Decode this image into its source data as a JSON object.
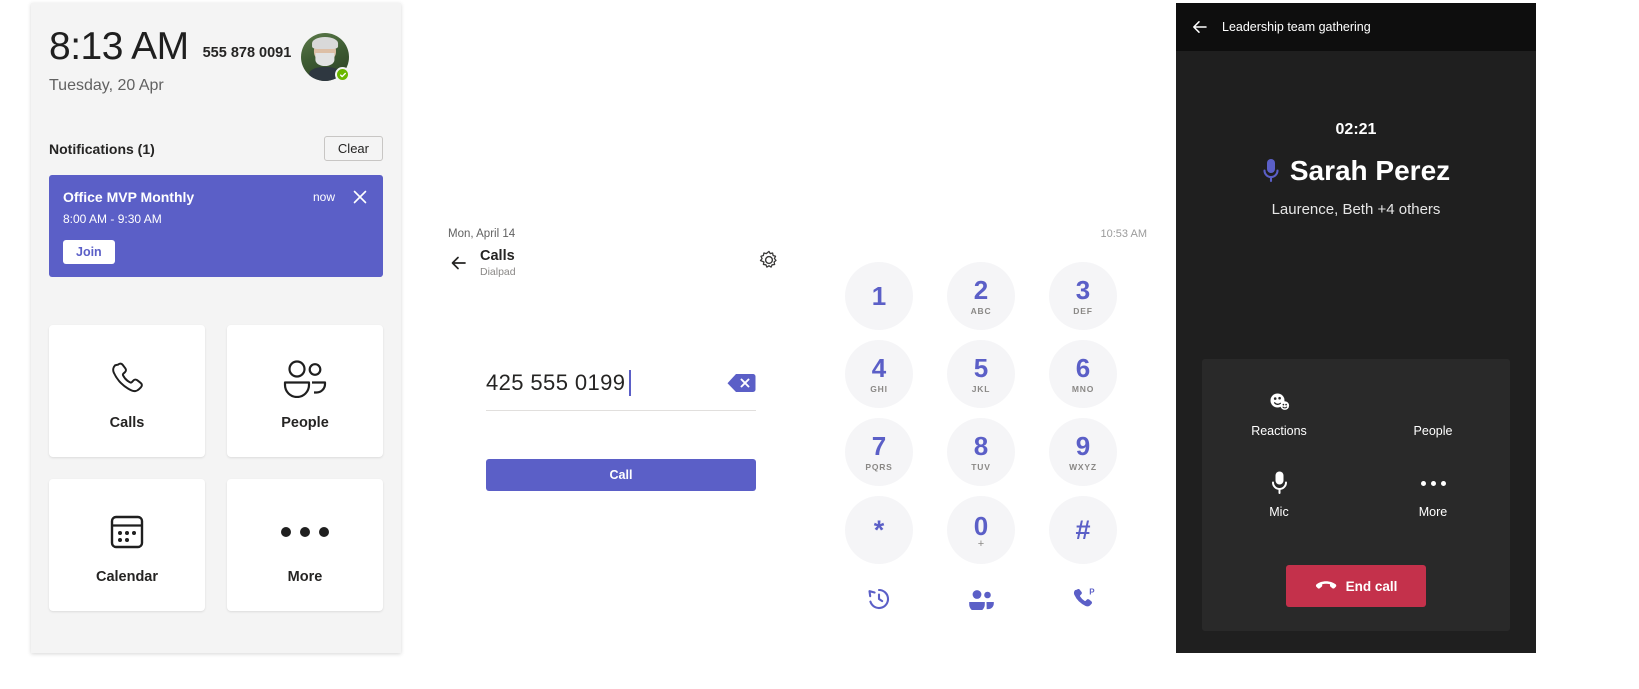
{
  "home": {
    "time": "8:13 AM",
    "phone_number": "555 878 0091",
    "date": "Tuesday, 20 Apr",
    "avatar_name": "avatar",
    "presence": "Available",
    "notifications_title": "Notifications (1)",
    "clear_label": "Clear",
    "notification": {
      "title": "Office MVP Monthly",
      "timestamp": "now",
      "time_range": "8:00 AM - 9:30 AM",
      "join_label": "Join"
    },
    "tiles": [
      {
        "label": "Calls",
        "icon": "phone-icon"
      },
      {
        "label": "People",
        "icon": "people-icon"
      },
      {
        "label": "Calendar",
        "icon": "calendar-icon"
      },
      {
        "label": "More",
        "icon": "more-dots-icon"
      }
    ]
  },
  "dialpad": {
    "date": "Mon, April 14",
    "status_time": "10:53 AM",
    "title": "Calls",
    "subtitle": "Dialpad",
    "back_icon": "back-arrow-icon",
    "settings_icon": "gear-icon",
    "entered_number": "425 555 0199",
    "backspace_icon": "backspace-icon",
    "call_label": "Call",
    "keys": [
      {
        "digit": "1",
        "letters": ""
      },
      {
        "digit": "2",
        "letters": "ABC"
      },
      {
        "digit": "3",
        "letters": "DEF"
      },
      {
        "digit": "4",
        "letters": "GHI"
      },
      {
        "digit": "5",
        "letters": "JKL"
      },
      {
        "digit": "6",
        "letters": "MNO"
      },
      {
        "digit": "7",
        "letters": "PQRS"
      },
      {
        "digit": "8",
        "letters": "TUV"
      },
      {
        "digit": "9",
        "letters": "WXYZ"
      },
      {
        "digit": "*",
        "letters": ""
      },
      {
        "digit": "0",
        "letters": "+"
      },
      {
        "digit": "#",
        "letters": ""
      }
    ],
    "actions": [
      {
        "icon": "history-icon"
      },
      {
        "icon": "contacts-icon"
      },
      {
        "icon": "park-call-icon"
      }
    ]
  },
  "call": {
    "meeting_title": "Leadership team gathering",
    "back_icon": "back-arrow-icon",
    "duration": "02:21",
    "active_speaker": "Sarah Perez",
    "speaker_icon": "mic-icon",
    "participants": "Laurence, Beth +4 others",
    "controls": [
      {
        "label": "Reactions",
        "icon": "reactions-icon"
      },
      {
        "label": "People",
        "icon": "people-icon"
      },
      {
        "label": "Mic",
        "icon": "mic-icon"
      },
      {
        "label": "More",
        "icon": "more-dots-icon"
      }
    ],
    "end_call_label": "End call",
    "end_call_icon": "end-call-icon",
    "accent_color": "#5b5fc7",
    "danger_color": "#c4314b"
  }
}
